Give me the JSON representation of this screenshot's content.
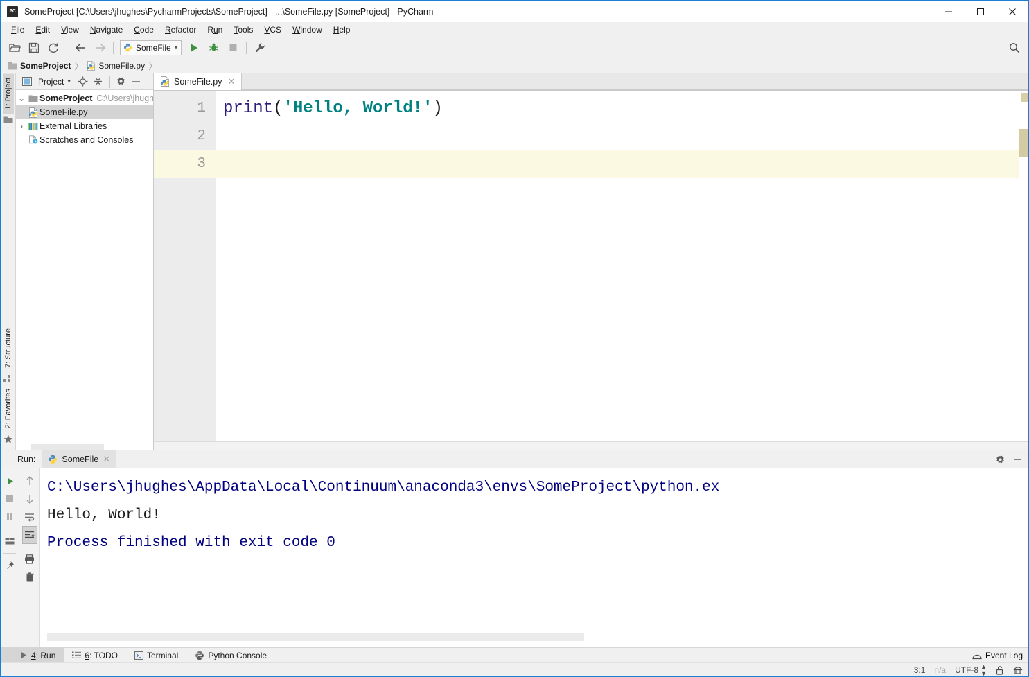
{
  "window": {
    "title": "SomeProject [C:\\Users\\jhughes\\PycharmProjects\\SomeProject] - ...\\SomeFile.py [SomeProject] - PyCharm",
    "app_icon": "PC",
    "minimize": "—",
    "maximize": "□",
    "close": "✕"
  },
  "menu": {
    "items": [
      {
        "label": "File",
        "mnemonic": "F",
        "rest": "ile"
      },
      {
        "label": "Edit",
        "mnemonic": "E",
        "rest": "dit"
      },
      {
        "label": "View",
        "mnemonic": "V",
        "rest": "iew"
      },
      {
        "label": "Navigate",
        "mnemonic": "N",
        "rest": "avigate"
      },
      {
        "label": "Code",
        "mnemonic": "C",
        "rest": "ode"
      },
      {
        "label": "Refactor",
        "mnemonic": "R",
        "rest": "efactor"
      },
      {
        "label": "Run",
        "mnemonic": "R",
        "rest": "un"
      },
      {
        "label": "Tools",
        "mnemonic": "T",
        "rest": "ools"
      },
      {
        "label": "VCS",
        "mnemonic": "V",
        "rest": "CS"
      },
      {
        "label": "Window",
        "mnemonic": "W",
        "rest": "indow"
      },
      {
        "label": "Help",
        "mnemonic": "H",
        "rest": "elp"
      }
    ]
  },
  "toolbar": {
    "open_icon": "open-folder-icon",
    "save_icon": "save-icon",
    "sync_icon": "refresh-icon",
    "back_icon": "arrow-left-icon",
    "forward_icon": "arrow-right-icon",
    "run_config_label": "SomeFile",
    "run_icon": "run-play-icon",
    "debug_icon": "debug-bug-icon",
    "stop_icon": "stop-square-icon",
    "settings_icon": "wrench-icon",
    "search_icon": "search-icon"
  },
  "breadcrumb": {
    "items": [
      {
        "label": "SomeProject",
        "icon": "folder-icon",
        "bold": true
      },
      {
        "label": "SomeFile.py",
        "icon": "python-file-icon",
        "bold": false
      }
    ],
    "separator": "〉"
  },
  "left_stripe": {
    "top_tab": "1: Project",
    "bottom_tabs": [
      "7: Structure",
      "2: Favorites"
    ]
  },
  "project_panel": {
    "header_label": "Project",
    "header_dropdown": "▾",
    "icons": [
      "project-view-icon",
      "locate-target-icon",
      "collapse-all-icon",
      "settings-gear-icon",
      "hide-panel-icon"
    ],
    "tree": [
      {
        "label": "SomeProject",
        "path": "C:\\Users\\jhugh",
        "icon": "folder-icon",
        "arrow": "⌄",
        "indent": 0,
        "bold": true,
        "selected": false
      },
      {
        "label": "SomeFile.py",
        "path": "",
        "icon": "python-file-icon",
        "arrow": "",
        "indent": 1,
        "bold": false,
        "selected": true
      },
      {
        "label": "External Libraries",
        "path": "",
        "icon": "libraries-icon",
        "arrow": "›",
        "indent": 0,
        "bold": false,
        "selected": false
      },
      {
        "label": "Scratches and Consoles",
        "path": "",
        "icon": "scratches-icon",
        "arrow": "",
        "indent": 0,
        "bold": false,
        "selected": false
      }
    ]
  },
  "editor": {
    "tab_label": "SomeFile.py",
    "tab_icon": "python-file-icon",
    "tab_close": "✕",
    "gutter_lines": [
      "1",
      "2",
      "3"
    ],
    "current_line": 3,
    "code_tokens": [
      {
        "text": "print",
        "type": "function"
      },
      {
        "text": "(",
        "type": "paren"
      },
      {
        "text": "'Hello, World!'",
        "type": "string"
      },
      {
        "text": ")",
        "type": "paren"
      }
    ],
    "code_plain": "print('Hello, World!')"
  },
  "run_panel": {
    "label": "Run:",
    "tab_label": "SomeFile",
    "tab_icon": "python-icon",
    "tab_close": "✕",
    "gear_icon": "settings-gear-icon",
    "minimize_icon": "hide-panel-icon",
    "left_tools": [
      "rerun-play-icon",
      "stop-icon",
      "pause-icon",
      "layout-icon",
      "pin-icon"
    ],
    "right_tools": [
      "arrow-up-icon",
      "arrow-down-icon",
      "soft-wrap-icon",
      "scroll-to-end-icon",
      "print-icon",
      "trash-icon"
    ],
    "console_lines": [
      {
        "text": "C:\\Users\\jhughes\\AppData\\Local\\Continuum\\anaconda3\\envs\\SomeProject\\python.ex",
        "style": "path"
      },
      {
        "text": "Hello, World!",
        "style": "plain"
      },
      {
        "text": "",
        "style": "plain"
      },
      {
        "text": "Process finished with exit code 0",
        "style": "path"
      }
    ]
  },
  "bottom_bar": {
    "tabs": [
      {
        "label": "4: Run",
        "mnemonic": "4",
        "rest": ": Run",
        "icon": "run-play-icon",
        "active": true
      },
      {
        "label": "6: TODO",
        "mnemonic": "6",
        "rest": ": TODO",
        "icon": "todo-list-icon",
        "active": false
      },
      {
        "label": "Terminal",
        "mnemonic": "",
        "rest": "Terminal",
        "icon": "terminal-icon",
        "active": false
      },
      {
        "label": "Python Console",
        "mnemonic": "",
        "rest": "Python Console",
        "icon": "python-console-icon",
        "active": false
      }
    ],
    "event_log": "Event Log",
    "event_log_icon": "event-log-icon"
  },
  "status_bar": {
    "caret_position": "3:1",
    "line_separator": "n/a",
    "encoding": "UTF-8",
    "encoding_arrows": "↕",
    "lock_icon": "unlocked-padlock-icon",
    "inspector_icon": "hector-inspector-icon"
  },
  "colors": {
    "accent_blue": "#1a7fd4",
    "string_teal": "#008080",
    "function_navy": "#2b1b7a",
    "console_navy": "#000080",
    "current_line_bg": "#fcf9e2",
    "chrome_bg": "#f0f0f0",
    "selection_bg": "#d4d4d4"
  }
}
